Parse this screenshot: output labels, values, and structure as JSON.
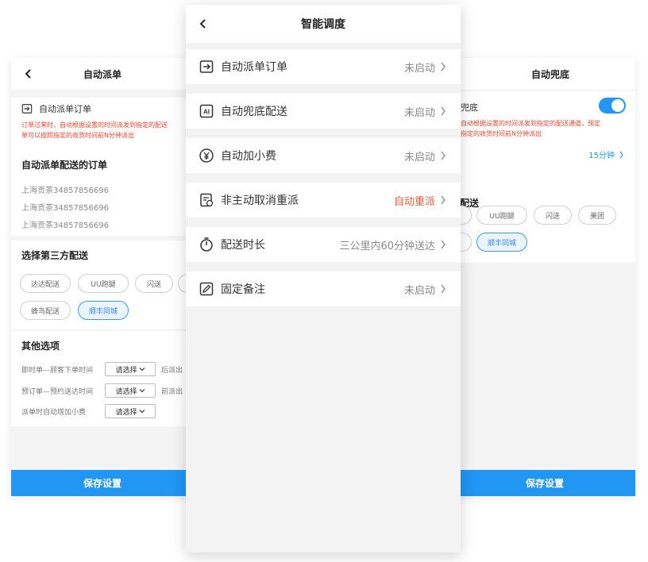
{
  "left": {
    "title": "自动派单",
    "feature_label": "自动派单订单",
    "note": [
      "订单过来时，自动根据设置的时间派发到指定的配送",
      "单可以按照指定的收货时间前N分钟派出"
    ],
    "orders_title": "自动派单配送的订单",
    "orders": [
      "上海贡茶34857856696",
      "上海贡茶34857856696",
      "上海贡茶34857856696"
    ],
    "third_party_title": "选择第三方配送",
    "chips": [
      "达达配送",
      "UU跑腿",
      "闪送",
      "蜂鸟配送",
      "顺丰同城"
    ],
    "active_chip": "顺丰同城",
    "other_title": "其他选项",
    "options": [
      {
        "label": "即时单—顾客下单时间",
        "select": "请选择",
        "suffix": "后派出"
      },
      {
        "label": "预订单—预约送达时间",
        "select": "请选择",
        "suffix": "前派出"
      },
      {
        "label": "派单时自动增加小费",
        "select": "请选择",
        "suffix": ""
      }
    ],
    "save_label": "保存设置"
  },
  "center": {
    "title": "智能调度",
    "items": [
      {
        "label": "自动派单订单",
        "status": "未启动",
        "icon": "dispatch-icon"
      },
      {
        "label": "自动兜底配送",
        "status": "未启动",
        "icon": "ai-icon"
      },
      {
        "label": "自动加小费",
        "status": "未启动",
        "icon": "yen-icon"
      },
      {
        "label": "非主动取消重派",
        "status": "自动重派",
        "icon": "redispatch-icon"
      },
      {
        "label": "配送时长",
        "status": "三公里内60分钟送达",
        "icon": "timer-icon"
      },
      {
        "label": "固定备注",
        "status": "未启动",
        "icon": "note-icon"
      }
    ],
    "warn_color": "#ee5a3a"
  },
  "right": {
    "title": "自动兜底",
    "feature_label": "兜底",
    "toggle_on": true,
    "note": [
      "自动根据设置的时间派发到指定的配送通道，预定",
      "指定的收货时间前N分钟派出"
    ],
    "time_value": "15分钟",
    "delivery_title": "配送",
    "chips": [
      "UU跑腿",
      "闪送",
      "美团",
      "顺丰同城"
    ],
    "active_chip": "顺丰同城",
    "save_label": "保存设置"
  },
  "colors": {
    "accent": "#2196f3",
    "warn": "#e8452d"
  }
}
